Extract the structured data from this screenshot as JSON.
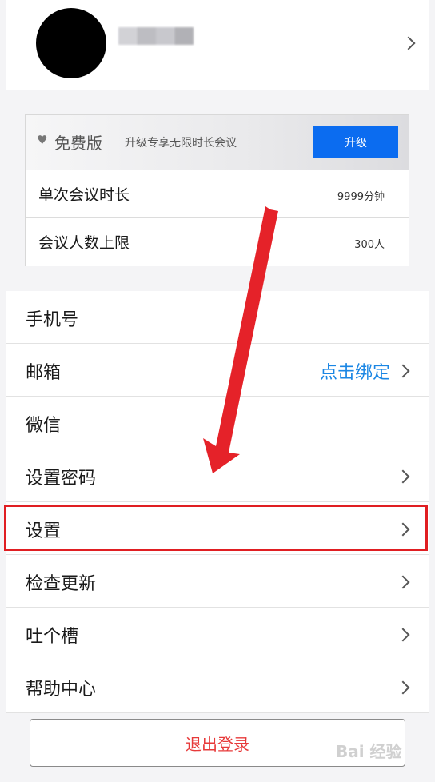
{
  "plan": {
    "name": "免费版",
    "description": "升级专享无限时长会议",
    "upgrade_label": "升级",
    "rows": [
      {
        "label": "单次会议时长",
        "value": "9999分钟"
      },
      {
        "label": "会议人数上限",
        "value": "300人"
      }
    ]
  },
  "menu": {
    "phone": "手机号",
    "email": "邮箱",
    "email_action": "点击绑定",
    "wechat": "微信",
    "set_password": "设置密码",
    "settings": "设置",
    "check_update": "检查更新",
    "feedback": "吐个槽",
    "help": "帮助中心"
  },
  "logout_label": "退出登录",
  "watermark": "Bai 经验",
  "colors": {
    "accent": "#0b6cf0",
    "highlight": "#e01e22",
    "logout": "#e73a3a",
    "link": "#1a86e4"
  }
}
